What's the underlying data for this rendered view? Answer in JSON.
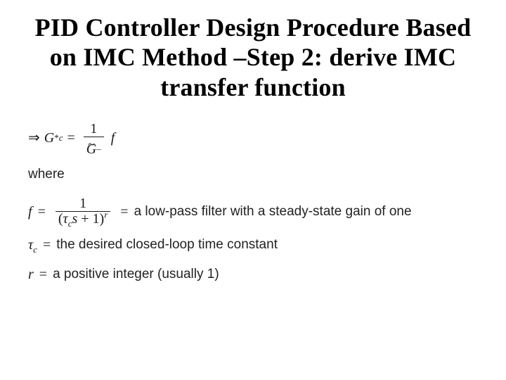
{
  "title": "PID Controller Design Procedure Based on IMC Method –Step 2: derive IMC transfer function",
  "eq1": {
    "arrow": "⇒",
    "Gc": "G",
    "Gc_star": "*",
    "Gc_sub": "c",
    "equals": "=",
    "num": "1",
    "den_G": "G",
    "den_tilde": "~",
    "den_sub": "–",
    "f": "f"
  },
  "where": "where",
  "eq2": {
    "f": "f",
    "equals": "=",
    "num": "1",
    "den_open": "(",
    "den_tau": "τ",
    "den_c": "c",
    "den_s": "s",
    "den_plus_one": " + 1)",
    "den_r": "r",
    "eq2equals": "=",
    "desc": "a low-pass filter with a steady-state gain of one"
  },
  "eq3": {
    "tau": "τ",
    "c": "c",
    "equals": "=",
    "desc": "the desired closed-loop time constant"
  },
  "eq4": {
    "r": "r",
    "equals": "=",
    "desc": "a positive integer (usually 1)"
  }
}
